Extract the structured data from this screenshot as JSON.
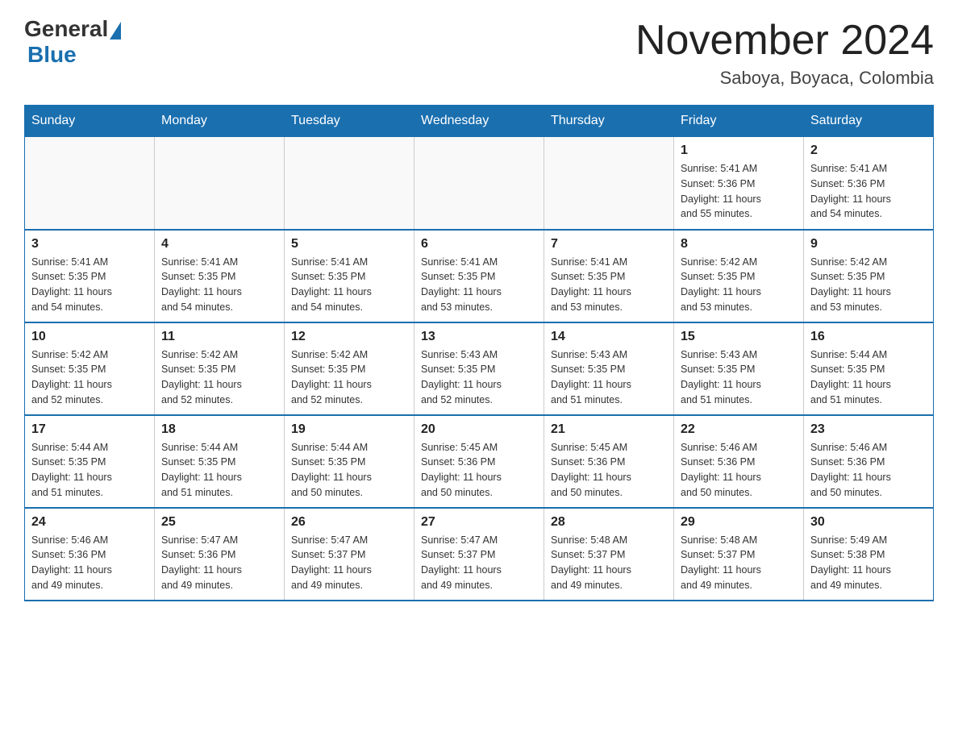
{
  "logo": {
    "general": "General",
    "blue": "Blue"
  },
  "title": "November 2024",
  "location": "Saboya, Boyaca, Colombia",
  "days_of_week": [
    "Sunday",
    "Monday",
    "Tuesday",
    "Wednesday",
    "Thursday",
    "Friday",
    "Saturday"
  ],
  "weeks": [
    [
      {
        "day": "",
        "info": ""
      },
      {
        "day": "",
        "info": ""
      },
      {
        "day": "",
        "info": ""
      },
      {
        "day": "",
        "info": ""
      },
      {
        "day": "",
        "info": ""
      },
      {
        "day": "1",
        "info": "Sunrise: 5:41 AM\nSunset: 5:36 PM\nDaylight: 11 hours\nand 55 minutes."
      },
      {
        "day": "2",
        "info": "Sunrise: 5:41 AM\nSunset: 5:36 PM\nDaylight: 11 hours\nand 54 minutes."
      }
    ],
    [
      {
        "day": "3",
        "info": "Sunrise: 5:41 AM\nSunset: 5:35 PM\nDaylight: 11 hours\nand 54 minutes."
      },
      {
        "day": "4",
        "info": "Sunrise: 5:41 AM\nSunset: 5:35 PM\nDaylight: 11 hours\nand 54 minutes."
      },
      {
        "day": "5",
        "info": "Sunrise: 5:41 AM\nSunset: 5:35 PM\nDaylight: 11 hours\nand 54 minutes."
      },
      {
        "day": "6",
        "info": "Sunrise: 5:41 AM\nSunset: 5:35 PM\nDaylight: 11 hours\nand 53 minutes."
      },
      {
        "day": "7",
        "info": "Sunrise: 5:41 AM\nSunset: 5:35 PM\nDaylight: 11 hours\nand 53 minutes."
      },
      {
        "day": "8",
        "info": "Sunrise: 5:42 AM\nSunset: 5:35 PM\nDaylight: 11 hours\nand 53 minutes."
      },
      {
        "day": "9",
        "info": "Sunrise: 5:42 AM\nSunset: 5:35 PM\nDaylight: 11 hours\nand 53 minutes."
      }
    ],
    [
      {
        "day": "10",
        "info": "Sunrise: 5:42 AM\nSunset: 5:35 PM\nDaylight: 11 hours\nand 52 minutes."
      },
      {
        "day": "11",
        "info": "Sunrise: 5:42 AM\nSunset: 5:35 PM\nDaylight: 11 hours\nand 52 minutes."
      },
      {
        "day": "12",
        "info": "Sunrise: 5:42 AM\nSunset: 5:35 PM\nDaylight: 11 hours\nand 52 minutes."
      },
      {
        "day": "13",
        "info": "Sunrise: 5:43 AM\nSunset: 5:35 PM\nDaylight: 11 hours\nand 52 minutes."
      },
      {
        "day": "14",
        "info": "Sunrise: 5:43 AM\nSunset: 5:35 PM\nDaylight: 11 hours\nand 51 minutes."
      },
      {
        "day": "15",
        "info": "Sunrise: 5:43 AM\nSunset: 5:35 PM\nDaylight: 11 hours\nand 51 minutes."
      },
      {
        "day": "16",
        "info": "Sunrise: 5:44 AM\nSunset: 5:35 PM\nDaylight: 11 hours\nand 51 minutes."
      }
    ],
    [
      {
        "day": "17",
        "info": "Sunrise: 5:44 AM\nSunset: 5:35 PM\nDaylight: 11 hours\nand 51 minutes."
      },
      {
        "day": "18",
        "info": "Sunrise: 5:44 AM\nSunset: 5:35 PM\nDaylight: 11 hours\nand 51 minutes."
      },
      {
        "day": "19",
        "info": "Sunrise: 5:44 AM\nSunset: 5:35 PM\nDaylight: 11 hours\nand 50 minutes."
      },
      {
        "day": "20",
        "info": "Sunrise: 5:45 AM\nSunset: 5:36 PM\nDaylight: 11 hours\nand 50 minutes."
      },
      {
        "day": "21",
        "info": "Sunrise: 5:45 AM\nSunset: 5:36 PM\nDaylight: 11 hours\nand 50 minutes."
      },
      {
        "day": "22",
        "info": "Sunrise: 5:46 AM\nSunset: 5:36 PM\nDaylight: 11 hours\nand 50 minutes."
      },
      {
        "day": "23",
        "info": "Sunrise: 5:46 AM\nSunset: 5:36 PM\nDaylight: 11 hours\nand 50 minutes."
      }
    ],
    [
      {
        "day": "24",
        "info": "Sunrise: 5:46 AM\nSunset: 5:36 PM\nDaylight: 11 hours\nand 49 minutes."
      },
      {
        "day": "25",
        "info": "Sunrise: 5:47 AM\nSunset: 5:36 PM\nDaylight: 11 hours\nand 49 minutes."
      },
      {
        "day": "26",
        "info": "Sunrise: 5:47 AM\nSunset: 5:37 PM\nDaylight: 11 hours\nand 49 minutes."
      },
      {
        "day": "27",
        "info": "Sunrise: 5:47 AM\nSunset: 5:37 PM\nDaylight: 11 hours\nand 49 minutes."
      },
      {
        "day": "28",
        "info": "Sunrise: 5:48 AM\nSunset: 5:37 PM\nDaylight: 11 hours\nand 49 minutes."
      },
      {
        "day": "29",
        "info": "Sunrise: 5:48 AM\nSunset: 5:37 PM\nDaylight: 11 hours\nand 49 minutes."
      },
      {
        "day": "30",
        "info": "Sunrise: 5:49 AM\nSunset: 5:38 PM\nDaylight: 11 hours\nand 49 minutes."
      }
    ]
  ]
}
